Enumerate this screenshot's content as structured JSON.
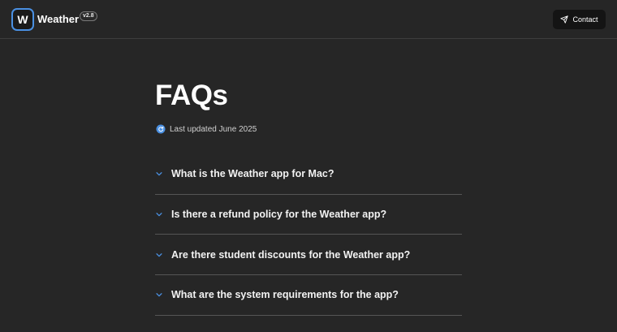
{
  "header": {
    "logo_letter": "W",
    "brand": "Weather",
    "version": "v2.8",
    "contact_label": "Contact"
  },
  "main": {
    "title": "FAQs",
    "updated": "Last updated June 2025"
  },
  "faqs": [
    {
      "question": "What is the Weather app for Mac?"
    },
    {
      "question": "Is there a refund policy for the Weather app?"
    },
    {
      "question": "Are there student discounts for the Weather app?"
    },
    {
      "question": "What are the system requirements for the app?"
    }
  ],
  "colors": {
    "background": "#262626",
    "accent": "#4a90e2",
    "divider": "#555555"
  },
  "icons": {
    "contact": "send-icon",
    "updated": "refresh-icon",
    "faq": "chevron-down-icon"
  }
}
